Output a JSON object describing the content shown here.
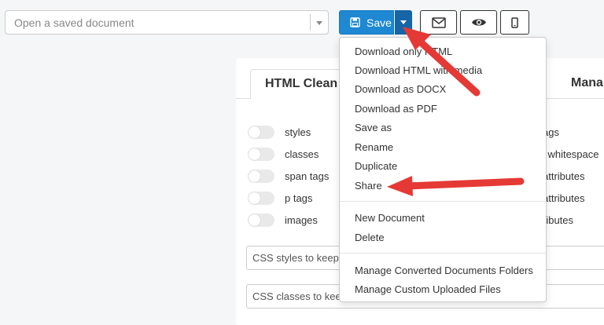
{
  "document_select": {
    "placeholder": "Open a saved document"
  },
  "toolbar": {
    "save_label": "Save",
    "icons": [
      "floppy-disk-icon",
      "caret-down-icon",
      "envelope-icon",
      "eye-icon",
      "mobile-phone-icon"
    ]
  },
  "tabs": [
    {
      "label": "HTML Clean"
    },
    {
      "label": "Mana"
    }
  ],
  "toggles": [
    {
      "label": "styles",
      "on": false
    },
    {
      "label": "classes",
      "on": false
    },
    {
      "label": "span tags",
      "on": false
    },
    {
      "label": "p tags",
      "on": false
    },
    {
      "label": "images",
      "on": false
    }
  ],
  "right_options": [
    "ags",
    "th whitespace",
    "attributes",
    "attributes",
    "ributes"
  ],
  "keep_fields": [
    {
      "label": "CSS styles to keep ("
    },
    {
      "label": "CSS classes to keep"
    }
  ],
  "menu": {
    "group1": [
      "Download only HTML",
      "Download HTML with media",
      "Download as DOCX",
      "Download as PDF",
      "Save as",
      "Rename",
      "Duplicate",
      "Share"
    ],
    "group2": [
      "New Document",
      "Delete"
    ],
    "group3": [
      "Manage Converted Documents Folders",
      "Manage Custom Uploaded Files"
    ]
  },
  "colors": {
    "save_button": "#1e88d3",
    "save_caret": "#1565a8",
    "annotation_arrow": "#e53935"
  }
}
